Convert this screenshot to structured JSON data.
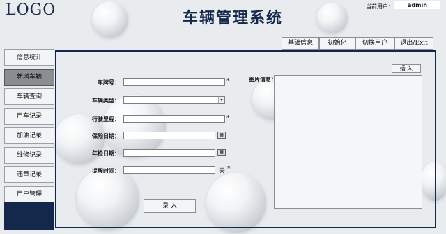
{
  "header": {
    "logo": "LOGO",
    "title": "车辆管理系统",
    "user_label": "当前用户：",
    "user_value": "admin"
  },
  "top_nav": [
    "基础信息",
    "初始化",
    "切换用户",
    "退出/Exit"
  ],
  "sidebar": {
    "items": [
      {
        "label": "信息统计",
        "active": false
      },
      {
        "label": "新增车辆",
        "active": true
      },
      {
        "label": "车辆查询",
        "active": false
      },
      {
        "label": "用车记录",
        "active": false
      },
      {
        "label": "加油记录",
        "active": false
      },
      {
        "label": "维修记录",
        "active": false
      },
      {
        "label": "违章记录",
        "active": false
      },
      {
        "label": "用户管理",
        "active": false
      }
    ]
  },
  "form": {
    "plate_label": "车牌号：",
    "plate_value": "",
    "type_label": "车辆类型：",
    "type_value": "",
    "mileage_label": "行驶里程：",
    "mileage_value": "",
    "insurance_label": "保险日期：",
    "insurance_value": "",
    "inspection_label": "年检日期：",
    "inspection_value": "",
    "reminder_label": "提醒时间：",
    "reminder_value": "",
    "reminder_unit": "天",
    "required_mark": "*",
    "submit_label": "录 入"
  },
  "image_panel": {
    "label": "图片信息：",
    "insert_label": "插 入"
  },
  "icons": {
    "calendar": "calendar-icon",
    "dropdown": "chevron-down-icon"
  },
  "colors": {
    "brand_navy": "#14284b",
    "active_item": "#8a8d92"
  }
}
